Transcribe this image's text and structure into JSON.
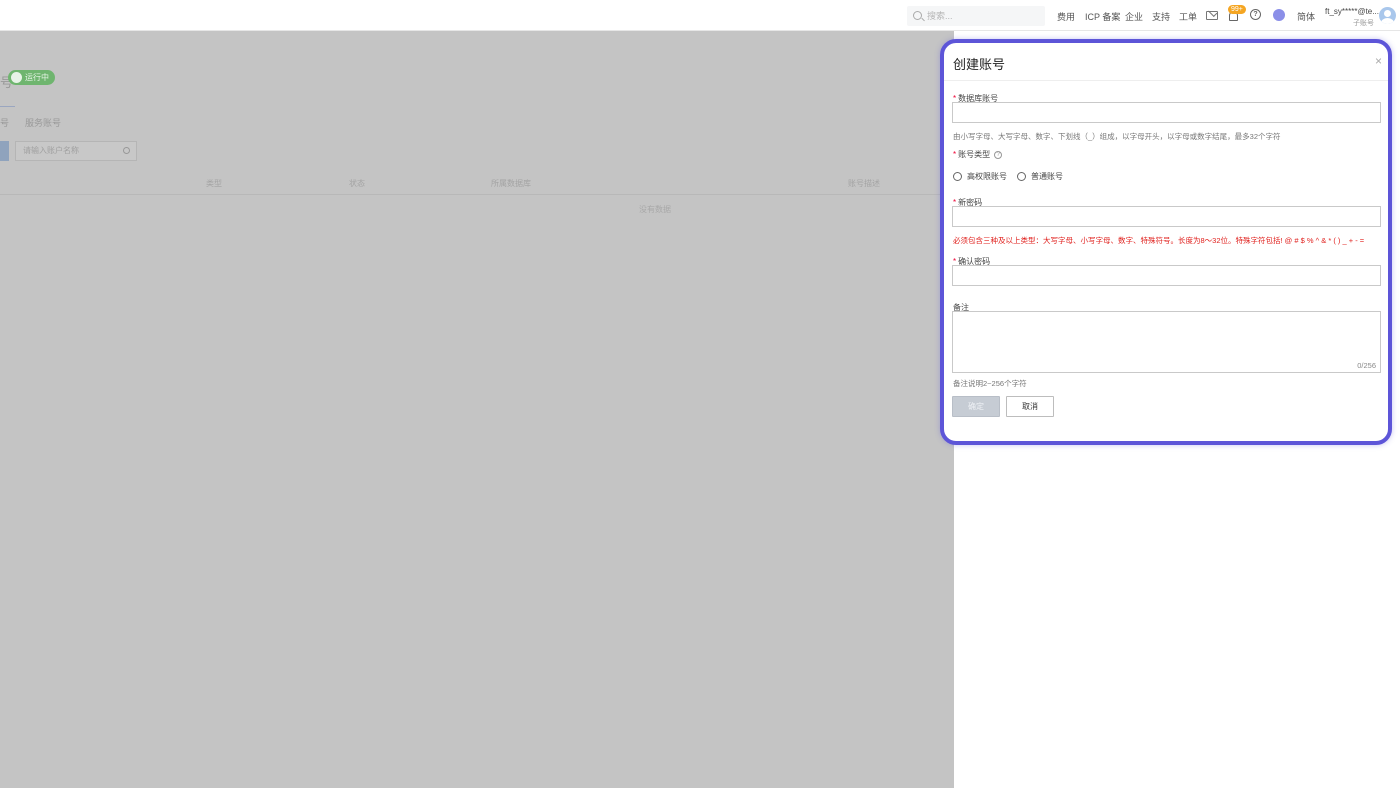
{
  "topbar": {
    "search_placeholder": "搜索...",
    "nav": [
      "费用",
      "ICP 备案",
      "企业",
      "支持",
      "工单"
    ],
    "notification_badge": "99+",
    "language": "简体",
    "user_name": "ft_sy*****@te...",
    "user_sub": "子账号"
  },
  "background": {
    "title_fragment": "号",
    "status": "运行中",
    "tabs": [
      "号",
      "服务账号"
    ],
    "search_placeholder": "请输入账户名称",
    "columns": [
      "类型",
      "状态",
      "所属数据库",
      "账号描述"
    ],
    "empty_text": "没有数据"
  },
  "drawer": {
    "title": "创建账号",
    "close_symbol": "×",
    "fields": {
      "db_account": {
        "label": "数据库账号",
        "value": "",
        "hint": "由小写字母、大写字母、数字、下划线（_）组成，以字母开头，以字母或数字结尾，最多32个字符"
      },
      "account_type": {
        "label": "账号类型",
        "options": [
          "高权限账号",
          "普通账号"
        ]
      },
      "new_password": {
        "label": "新密码",
        "value": "",
        "hint": "必须包含三种及以上类型：大写字母、小写字母、数字、特殊符号。长度为8～32位。特殊字符包括! @ # $ % ^ & * ( ) _ + - ="
      },
      "confirm_password": {
        "label": "确认密码",
        "value": ""
      },
      "remark": {
        "label": "备注",
        "value": "",
        "counter": "0/256",
        "hint": "备注说明2~256个字符"
      }
    },
    "buttons": {
      "ok": "确定",
      "cancel": "取消"
    }
  },
  "colors": {
    "highlight_border": "#5d55d8",
    "error_text": "#e0201d",
    "status_green": "#6fb56f",
    "overlay": "#c4c4c4"
  }
}
